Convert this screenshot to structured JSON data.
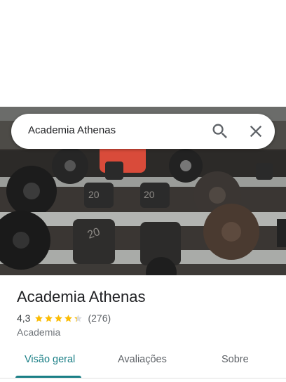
{
  "search": {
    "query": "Academia Athenas"
  },
  "place": {
    "title": "Academia Athenas",
    "rating": "4,3",
    "stars_filled": 4.3,
    "review_count": "(276)",
    "category": "Academia"
  },
  "tabs": [
    {
      "label": "Visão geral",
      "active": true
    },
    {
      "label": "Avaliações",
      "active": false
    },
    {
      "label": "Sobre",
      "active": false
    }
  ],
  "colors": {
    "accent": "#1a7f86",
    "star": "#fbbc04",
    "star_empty": "#dadce0"
  },
  "icons": {
    "search": "search-icon",
    "close": "close-icon",
    "star": "star-icon"
  },
  "hero": {
    "weight_labels": [
      "20",
      "20",
      "20"
    ]
  }
}
